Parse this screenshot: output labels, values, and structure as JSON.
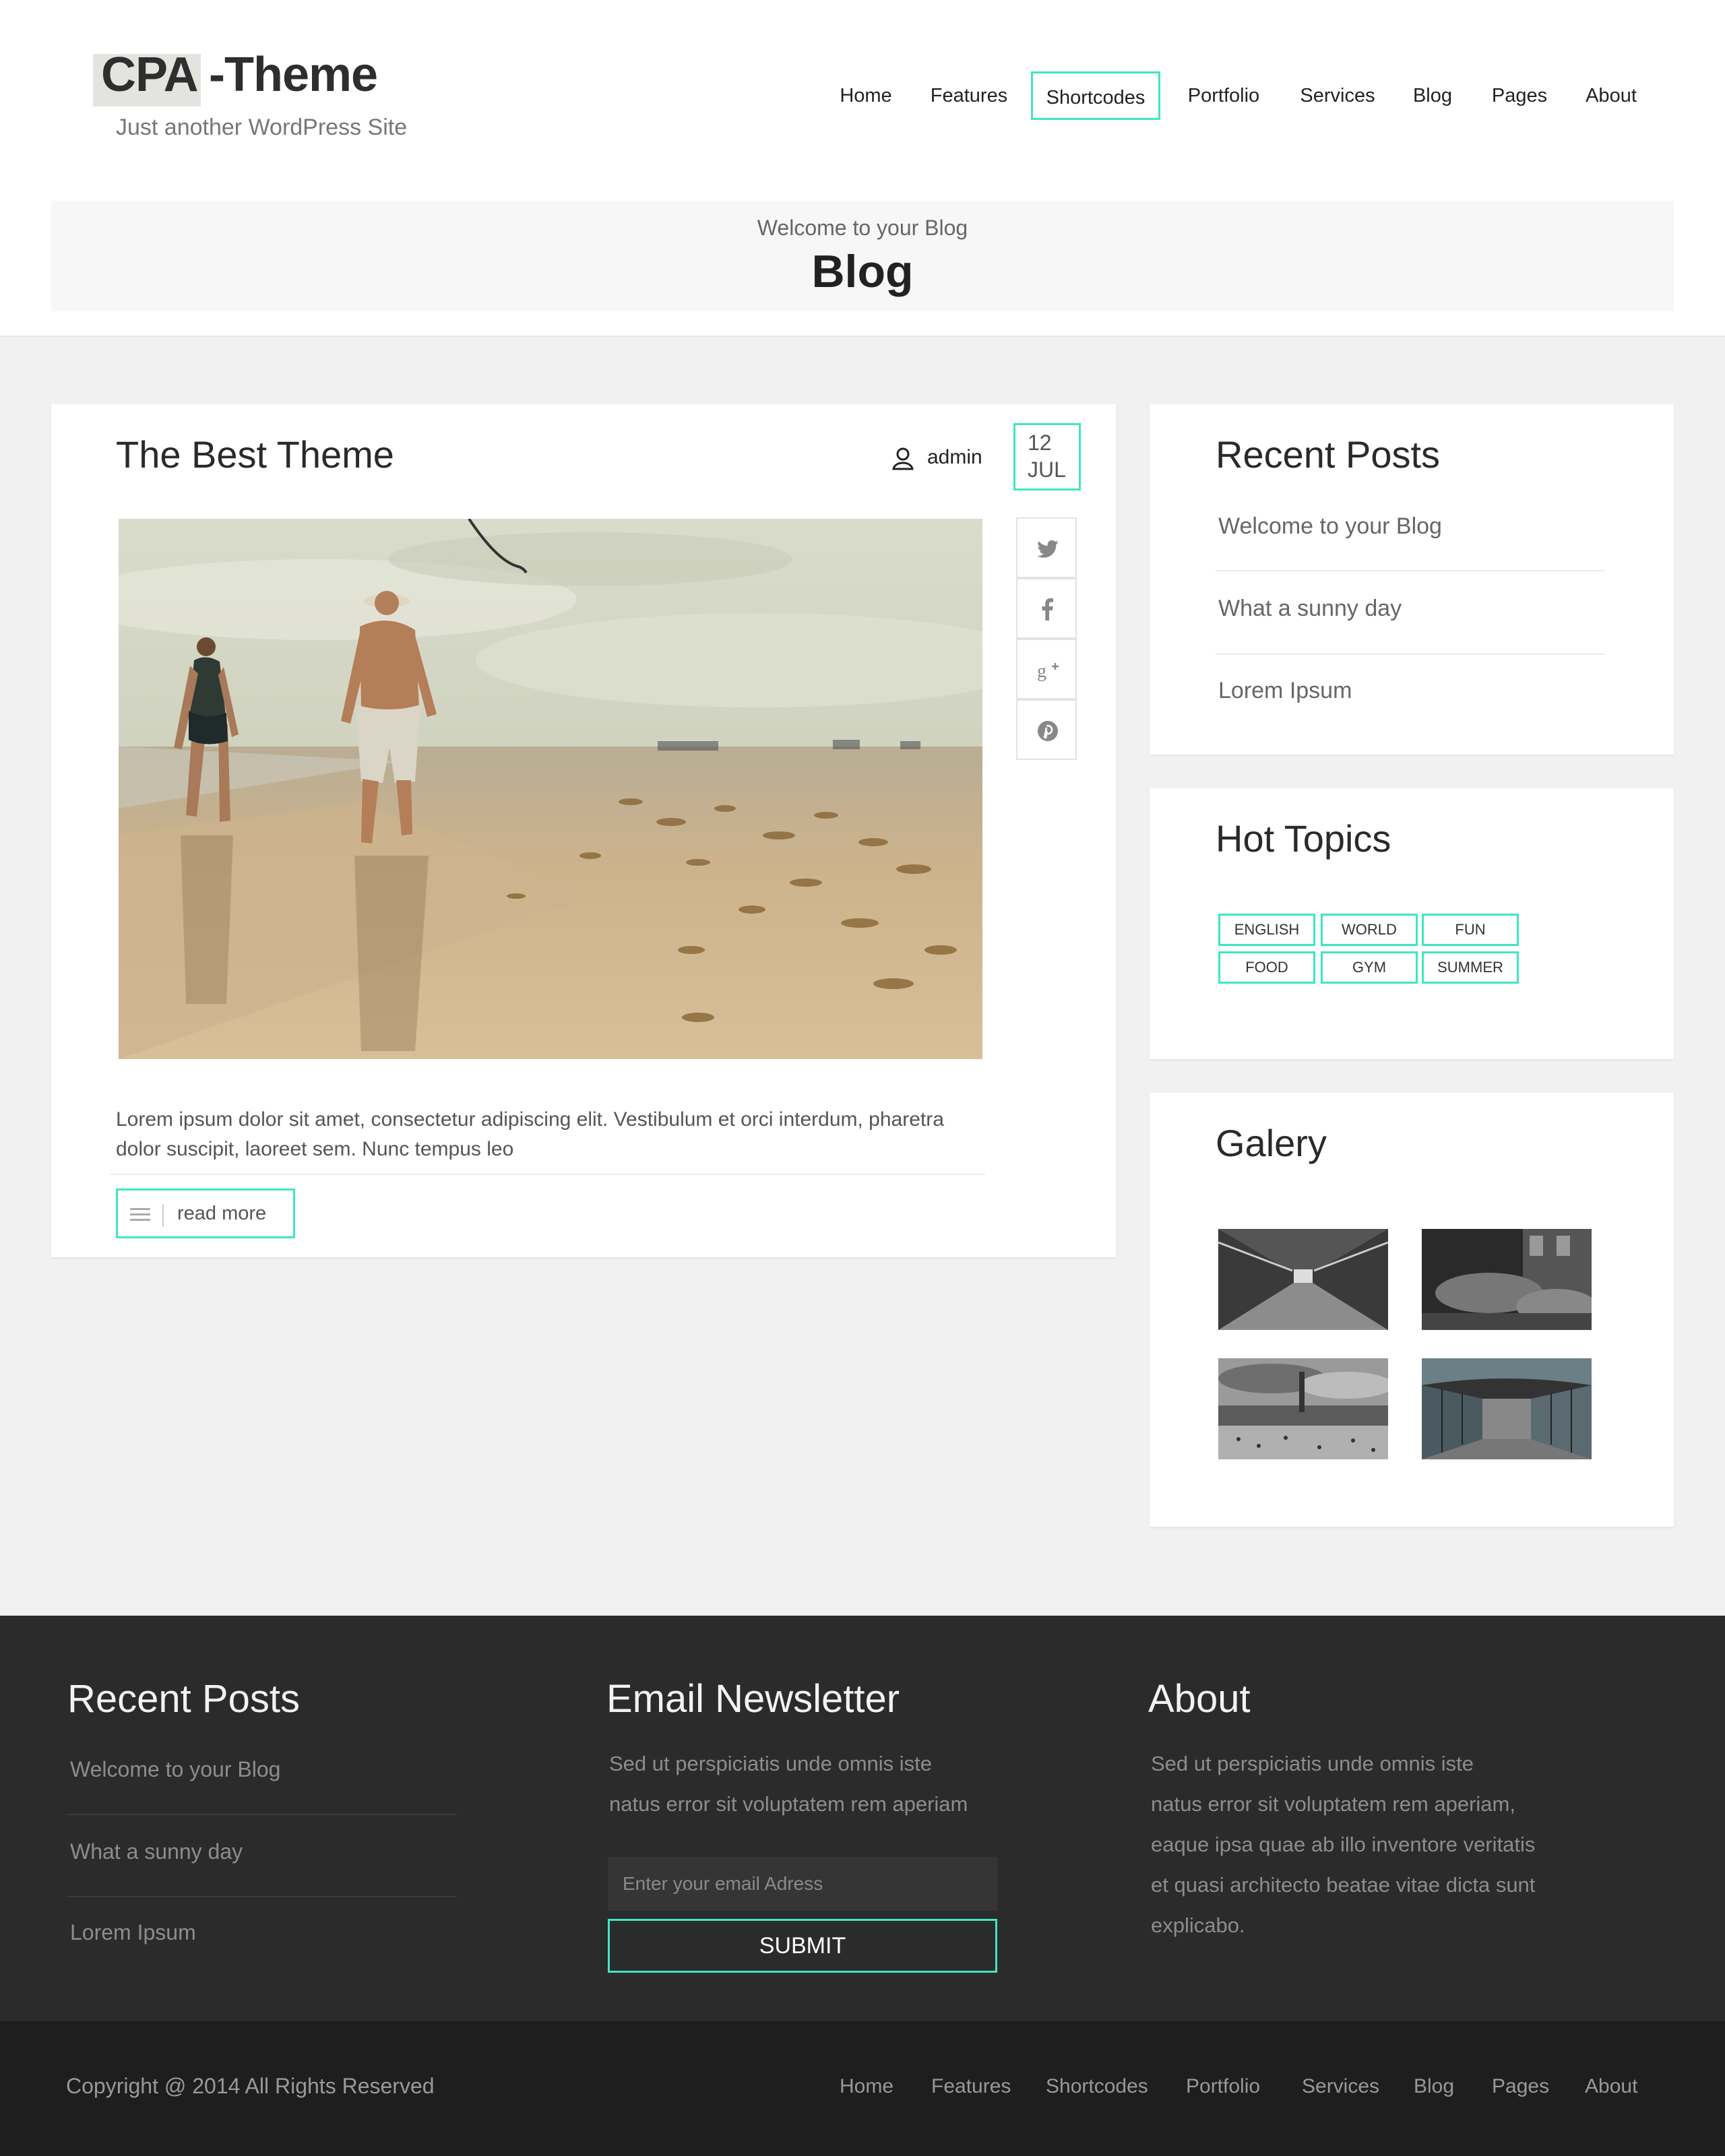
{
  "site": {
    "logo": "CPA -Theme",
    "tagline": "Just another WordPress Site"
  },
  "nav": {
    "items": [
      {
        "label": "Home"
      },
      {
        "label": "Features"
      },
      {
        "label": "Shortcodes",
        "active": true
      },
      {
        "label": "Portfolio"
      },
      {
        "label": "Services"
      },
      {
        "label": "Blog"
      },
      {
        "label": "Pages"
      },
      {
        "label": "About"
      }
    ]
  },
  "hero": {
    "subtitle": "Welcome to your Blog",
    "title": "Blog"
  },
  "post": {
    "title": "The Best Theme",
    "author": "admin",
    "date": {
      "day": "12",
      "month": "JUL"
    },
    "share_icons": [
      "twitter-icon",
      "facebook-icon",
      "google-plus-icon",
      "pinterest-icon"
    ],
    "excerpt": "Lorem ipsum dolor sit amet, consectetur adipiscing elit. Vestibulum et orci interdum, pharetra dolor suscipit, laoreet sem. Nunc tempus leo",
    "read_more": "read more"
  },
  "sidebar": {
    "recent_posts": {
      "title": "Recent Posts",
      "items": [
        "Welcome to your Blog",
        "What a sunny day",
        "Lorem Ipsum"
      ]
    },
    "hot_topics": {
      "title": "Hot Topics",
      "tags": [
        "ENGLISH",
        "WORLD",
        "FUN",
        "FOOD",
        "GYM",
        "SUMMER"
      ]
    },
    "gallery": {
      "title": "Galery"
    }
  },
  "footer": {
    "recent_posts": {
      "title": "Recent Posts",
      "items": [
        "Welcome to your Blog",
        "What a sunny day",
        "Lorem Ipsum"
      ]
    },
    "newsletter": {
      "title": "Email Newsletter",
      "text_line1": "Sed ut perspiciatis unde omnis iste",
      "text_line2": "natus error sit voluptatem rem aperiam",
      "placeholder": "Enter your email Adress",
      "submit": "SUBMIT"
    },
    "about": {
      "title": "About",
      "lines": [
        "Sed ut perspiciatis unde omnis iste",
        "natus error sit voluptatem rem aperiam,",
        "eaque ipsa quae ab illo inventore veritatis",
        "et quasi architecto beatae vitae dicta sunt",
        "explicabo."
      ]
    },
    "copyright": "Copyright @ 2014 All Rights Reserved",
    "nav": [
      "Home",
      "Features",
      "Shortcodes",
      "Portfolio",
      "Services",
      "Blog",
      "Pages",
      "About"
    ]
  },
  "colors": {
    "accent": "#3ee6c4",
    "footer_bg": "#2b2b2b",
    "bottom_bar_bg": "#1e1e1e"
  }
}
